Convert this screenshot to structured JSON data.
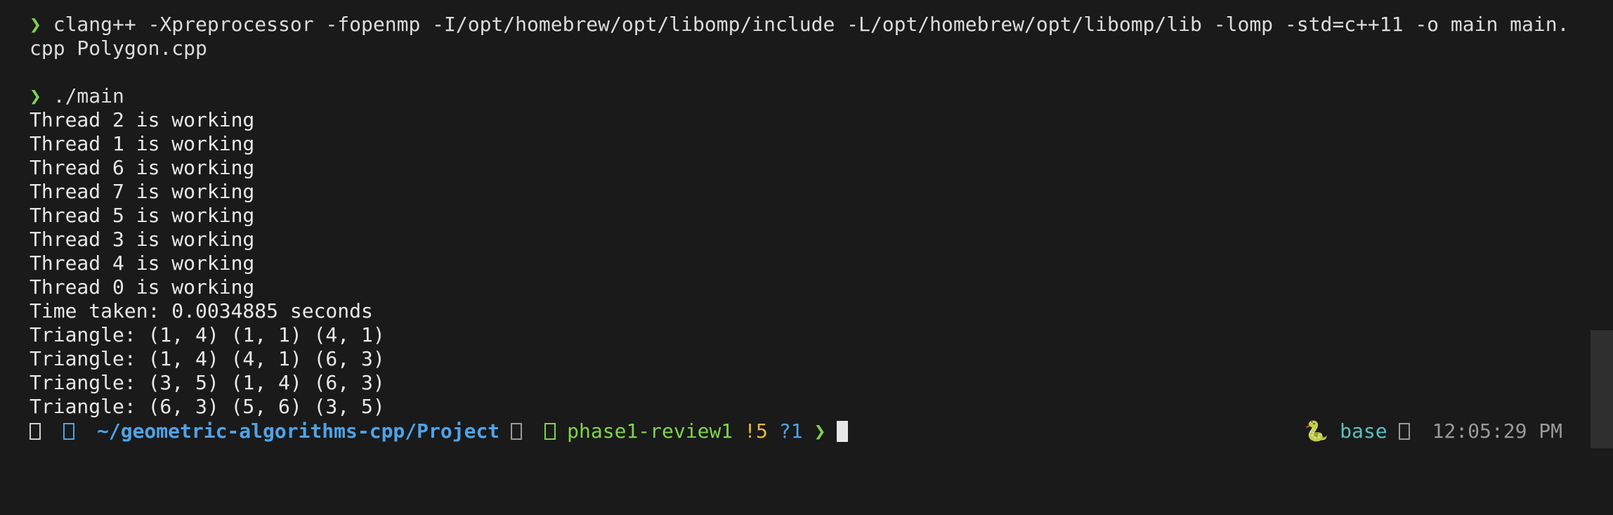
{
  "terminal": {
    "commands": [
      {
        "prompt": "❯",
        "lines": [
          "clang++ -Xpreprocessor -fopenmp -I/opt/homebrew/opt/libomp/include -L/opt/homebrew/opt/libomp/lib -lomp -std=c++11 -o main main.",
          "cpp Polygon.cpp"
        ]
      },
      {
        "prompt": "❯",
        "lines": [
          "./main"
        ]
      }
    ],
    "output": [
      "Thread 2 is working",
      "Thread 1 is working",
      "Thread 6 is working",
      "Thread 7 is working",
      "Thread 5 is working",
      "Thread 3 is working",
      "Thread 4 is working",
      "Thread 0 is working",
      "Time taken: 0.0034885 seconds",
      "Triangle: (1, 4) (1, 1) (4, 1)",
      "Triangle: (1, 4) (4, 1) (6, 3)",
      "Triangle: (3, 5) (1, 4) (6, 3)",
      "Triangle: (6, 3) (5, 6) (3, 5)"
    ]
  },
  "statusbar": {
    "icons": [
      "apple-icon",
      "folder-icon",
      "git-icon",
      "branch-icon",
      "python-icon",
      "clock-icon"
    ],
    "directory": "~/geometric-algorithms-cpp/Project",
    "branch": "phase1-review1",
    "modified": "!5",
    "untracked": "?1",
    "chevron": "❯",
    "env_icon": "🐍",
    "env_name": "base",
    "time": "12:05:29 PM"
  },
  "colors": {
    "background": "#1a1a1a",
    "prompt": "#7fd44b",
    "directory": "#4fa3e8",
    "modified": "#e3b93d",
    "env": "#5bc0be"
  }
}
